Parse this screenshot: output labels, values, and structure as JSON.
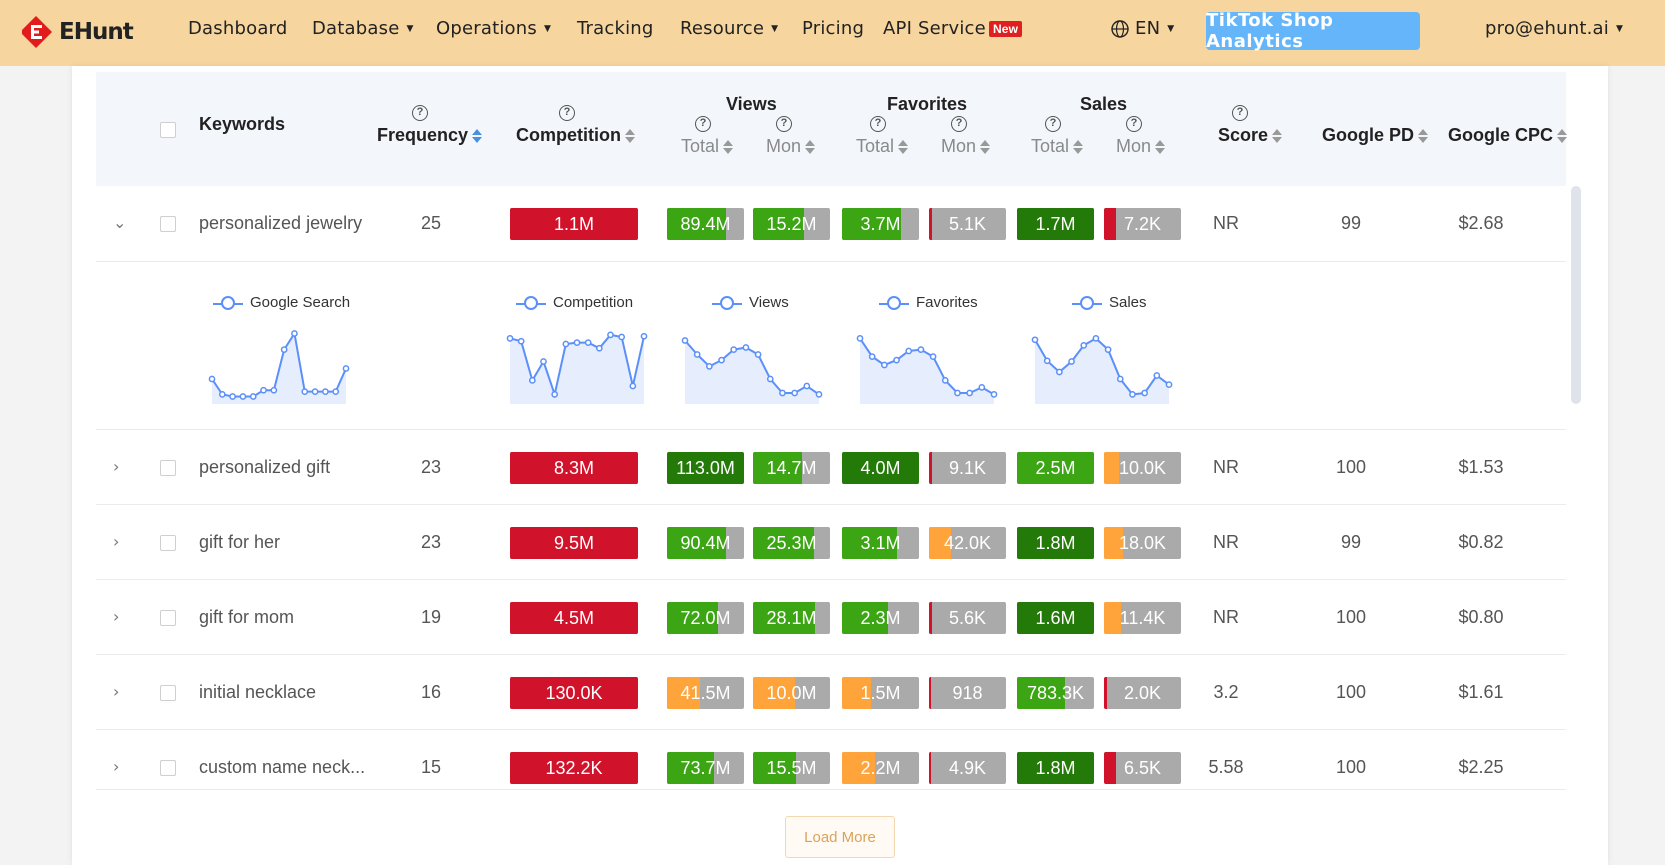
{
  "nav": {
    "logo_text": "EHunt",
    "items": [
      {
        "label": "Dashboard",
        "caret": false
      },
      {
        "label": "Database",
        "caret": true
      },
      {
        "label": "Operations",
        "caret": true
      },
      {
        "label": "Tracking",
        "caret": false
      },
      {
        "label": "Resource",
        "caret": true
      },
      {
        "label": "Pricing",
        "caret": false
      },
      {
        "label": "API Service",
        "caret": false
      }
    ],
    "new_badge": "New",
    "language": "EN",
    "tiktok_button": "TikTok Shop Analytics",
    "account": "pro@ehunt.ai"
  },
  "colors": {
    "nav_bg": "#f7d59e",
    "red": "#d0132b",
    "green": "#3ca514",
    "dark_green": "#247a08",
    "orange": "#ffa43a",
    "gray_bar": "#aaaaaa",
    "accent_blue": "#5b8ff9",
    "sort_active": "#4a90e2"
  },
  "table": {
    "headers": {
      "keywords": "Keywords",
      "frequency": "Frequency",
      "competition": "Competition",
      "views": "Views",
      "favorites": "Favorites",
      "sales": "Sales",
      "total": "Total",
      "mon": "Mon",
      "score": "Score",
      "google_pd": "Google PD",
      "google_cpc": "Google CPC"
    },
    "rows": [
      {
        "keyword": "personalized jewelry",
        "frequency": "25",
        "competition": "1.1M",
        "views_total": "89.4M",
        "views_mon": "15.2M",
        "fav_total": "3.7M",
        "fav_mon": "5.1K",
        "sales_total": "1.7M",
        "sales_mon": "7.2K",
        "score": "NR",
        "google_pd": "99",
        "google_cpc": "$2.68",
        "expanded": true
      },
      {
        "keyword": "personalized gift",
        "frequency": "23",
        "competition": "8.3M",
        "views_total": "113.0M",
        "views_mon": "14.7M",
        "fav_total": "4.0M",
        "fav_mon": "9.1K",
        "sales_total": "2.5M",
        "sales_mon": "10.0K",
        "score": "NR",
        "google_pd": "100",
        "google_cpc": "$1.53",
        "expanded": false
      },
      {
        "keyword": "gift for her",
        "frequency": "23",
        "competition": "9.5M",
        "views_total": "90.4M",
        "views_mon": "25.3M",
        "fav_total": "3.1M",
        "fav_mon": "42.0K",
        "sales_total": "1.8M",
        "sales_mon": "18.0K",
        "score": "NR",
        "google_pd": "99",
        "google_cpc": "$0.82",
        "expanded": false
      },
      {
        "keyword": "gift for mom",
        "frequency": "19",
        "competition": "4.5M",
        "views_total": "72.0M",
        "views_mon": "28.1M",
        "fav_total": "2.3M",
        "fav_mon": "5.6K",
        "sales_total": "1.6M",
        "sales_mon": "11.4K",
        "score": "NR",
        "google_pd": "100",
        "google_cpc": "$0.80",
        "expanded": false
      },
      {
        "keyword": "initial necklace",
        "frequency": "16",
        "competition": "130.0K",
        "views_total": "41.5M",
        "views_mon": "10.0M",
        "fav_total": "1.5M",
        "fav_mon": "918",
        "sales_total": "783.3K",
        "sales_mon": "2.0K",
        "score": "3.2",
        "google_pd": "100",
        "google_cpc": "$1.61",
        "expanded": false
      },
      {
        "keyword": "custom name neck...",
        "frequency": "15",
        "competition": "132.2K",
        "views_total": "73.7M",
        "views_mon": "15.5M",
        "fav_total": "2.2M",
        "fav_mon": "4.9K",
        "sales_total": "1.8M",
        "sales_mon": "6.5K",
        "score": "5.58",
        "google_pd": "100",
        "google_cpc": "$2.25",
        "expanded": false
      }
    ],
    "bar_levels": [
      {
        "competition": 1.0,
        "views_total": 0.76,
        "views_mon": 0.66,
        "fav_total": 0.76,
        "fav_mon": 0.04,
        "sales_total": 1.0,
        "sales_mon": 0.15
      },
      {
        "competition": 1.0,
        "views_total": 1.0,
        "views_mon": 0.64,
        "fav_total": 1.0,
        "fav_mon": 0.04,
        "sales_total": 1.0,
        "sales_mon": 0.2
      },
      {
        "competition": 1.0,
        "views_total": 0.76,
        "views_mon": 0.79,
        "fav_total": 0.71,
        "fav_mon": 0.29,
        "sales_total": 1.0,
        "sales_mon": 0.25
      },
      {
        "competition": 1.0,
        "views_total": 0.66,
        "views_mon": 0.81,
        "fav_total": 0.6,
        "fav_mon": 0.04,
        "sales_total": 1.0,
        "sales_mon": 0.22
      },
      {
        "competition": 1.0,
        "views_total": 0.43,
        "views_mon": 0.54,
        "fav_total": 0.38,
        "fav_mon": 0.02,
        "sales_total": 0.62,
        "sales_mon": 0.04
      },
      {
        "competition": 1.0,
        "views_total": 0.61,
        "views_mon": 0.56,
        "fav_total": 0.43,
        "fav_mon": 0.02,
        "sales_total": 1.0,
        "sales_mon": 0.15
      }
    ],
    "bar_colors": [
      {
        "views_total": "green",
        "views_mon": "green",
        "fav_total": "green",
        "fav_mon": "red",
        "sales_total": "dark_green",
        "sales_mon": "red"
      },
      {
        "views_total": "dark_green",
        "views_mon": "green",
        "fav_total": "dark_green",
        "fav_mon": "red",
        "sales_total": "green",
        "sales_mon": "orange"
      },
      {
        "views_total": "green",
        "views_mon": "green",
        "fav_total": "green",
        "fav_mon": "orange",
        "sales_total": "dark_green",
        "sales_mon": "orange"
      },
      {
        "views_total": "green",
        "views_mon": "green",
        "fav_total": "green",
        "fav_mon": "red",
        "sales_total": "dark_green",
        "sales_mon": "orange"
      },
      {
        "views_total": "orange",
        "views_mon": "orange",
        "fav_total": "orange",
        "fav_mon": "red",
        "sales_total": "green",
        "sales_mon": "red"
      },
      {
        "views_total": "green",
        "views_mon": "green",
        "fav_total": "orange",
        "fav_mon": "red",
        "sales_total": "dark_green",
        "sales_mon": "red"
      }
    ]
  },
  "chart_data": [
    {
      "type": "line",
      "legend": "Google Search",
      "values": [
        30,
        8,
        5,
        5,
        5,
        14,
        14,
        72,
        95,
        12,
        12,
        12,
        12,
        45
      ]
    },
    {
      "type": "line",
      "legend": "Competition",
      "values": [
        88,
        84,
        28,
        55,
        8,
        80,
        82,
        82,
        74,
        93,
        90,
        20,
        91
      ]
    },
    {
      "type": "line",
      "legend": "Views",
      "values": [
        85,
        65,
        48,
        57,
        72,
        75,
        65,
        30,
        10,
        10,
        20,
        8
      ]
    },
    {
      "type": "line",
      "legend": "Favorites",
      "values": [
        88,
        62,
        50,
        57,
        70,
        72,
        62,
        28,
        10,
        10,
        18,
        8
      ]
    },
    {
      "type": "line",
      "legend": "Sales",
      "values": [
        86,
        56,
        40,
        55,
        78,
        88,
        72,
        30,
        8,
        10,
        35,
        22
      ]
    }
  ],
  "load_more": "Load More"
}
